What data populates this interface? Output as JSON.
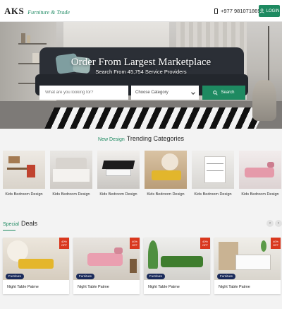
{
  "header": {
    "logo_mark": "AKS",
    "logo_sub": "Furniture & Trade",
    "phone": "+977 9810718698",
    "login_label": "LOGIN"
  },
  "hero": {
    "title": "Order From Largest Marketplace",
    "subtitle": "Search From 45,754 Service Providers",
    "search_placeholder": "What are you looking for?",
    "category_label": "Choose Category",
    "search_button": "Search"
  },
  "trending": {
    "accent": "New Design",
    "title": "Trending Categories",
    "items": [
      {
        "label": "Kids Bedroom Design"
      },
      {
        "label": "Kids Bedroom Design"
      },
      {
        "label": "Kids Bedroom Design"
      },
      {
        "label": "Kids Bedroom Design"
      },
      {
        "label": "Kids Bedroom Design"
      },
      {
        "label": "Kids Bedroom Design"
      }
    ]
  },
  "deals": {
    "accent": "Special",
    "title": "Deals",
    "prev_arrow": "‹",
    "next_arrow": "›",
    "items": [
      {
        "off": "40% OFF",
        "badge": "Furniture",
        "name": "Night Table Patme"
      },
      {
        "off": "40% OFF",
        "badge": "Furniture",
        "name": "Night Table Patme"
      },
      {
        "off": "40% OFF",
        "badge": "Furniture",
        "name": "Night Table Patme"
      },
      {
        "off": "40% OFF",
        "badge": "Furniture",
        "name": "Night Table Patme"
      }
    ]
  },
  "colors": {
    "brand_green": "#1e8a61",
    "discount_red": "#d9381e",
    "badge_navy": "#1a2a5a"
  }
}
